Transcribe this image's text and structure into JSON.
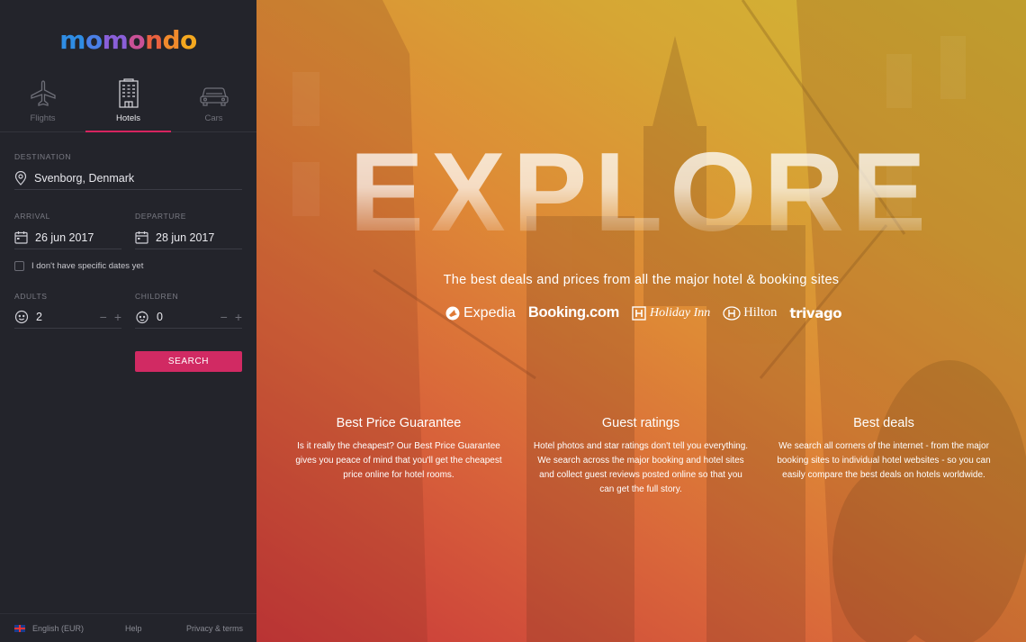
{
  "brand": {
    "logo_text": "momondo"
  },
  "tabs": [
    {
      "label": "Flights",
      "icon": "airplane-icon",
      "active": false
    },
    {
      "label": "Hotels",
      "icon": "hotel-building-icon",
      "active": true
    },
    {
      "label": "Cars",
      "icon": "car-icon",
      "active": false
    }
  ],
  "search_form": {
    "destination_label": "DESTINATION",
    "destination_value": "Svenborg, Denmark",
    "arrival_label": "ARRIVAL",
    "arrival_value": "26 jun 2017",
    "departure_label": "DEPARTURE",
    "departure_value": "28 jun 2017",
    "no_dates_label": "I don't have specific dates yet",
    "adults_label": "ADULTS",
    "adults_value": "2",
    "children_label": "CHILDREN",
    "children_value": "0",
    "minus": "−",
    "plus": "+",
    "search_label": "SEARCH"
  },
  "footer": {
    "language": "English (EUR)",
    "help": "Help",
    "privacy": "Privacy & terms"
  },
  "hero": {
    "headline": "EXPLORE",
    "tagline": "The best deals and prices from all the major hotel & booking sites",
    "partners": [
      "Expedia",
      "Booking.com",
      "Holiday Inn",
      "Hilton",
      "trivago"
    ],
    "features": [
      {
        "title": "Best Price Guarantee",
        "text": "Is it really the cheapest? Our Best Price Guarantee gives you peace of mind that you'll get the cheapest price online for hotel rooms."
      },
      {
        "title": "Guest ratings",
        "text": "Hotel photos and star ratings don't tell you everything. We search across the major booking and hotel sites and collect guest reviews posted online so that you can get the full story."
      },
      {
        "title": "Best deals",
        "text": "We search all corners of the internet - from the major booking sites to individual hotel websites - so you can easily compare the best deals on hotels worldwide."
      }
    ]
  },
  "colors": {
    "accent": "#d12a63",
    "sidebar_bg": "#23242b",
    "gradient_red": "#c8353a",
    "gradient_yellow": "#cfb833"
  }
}
